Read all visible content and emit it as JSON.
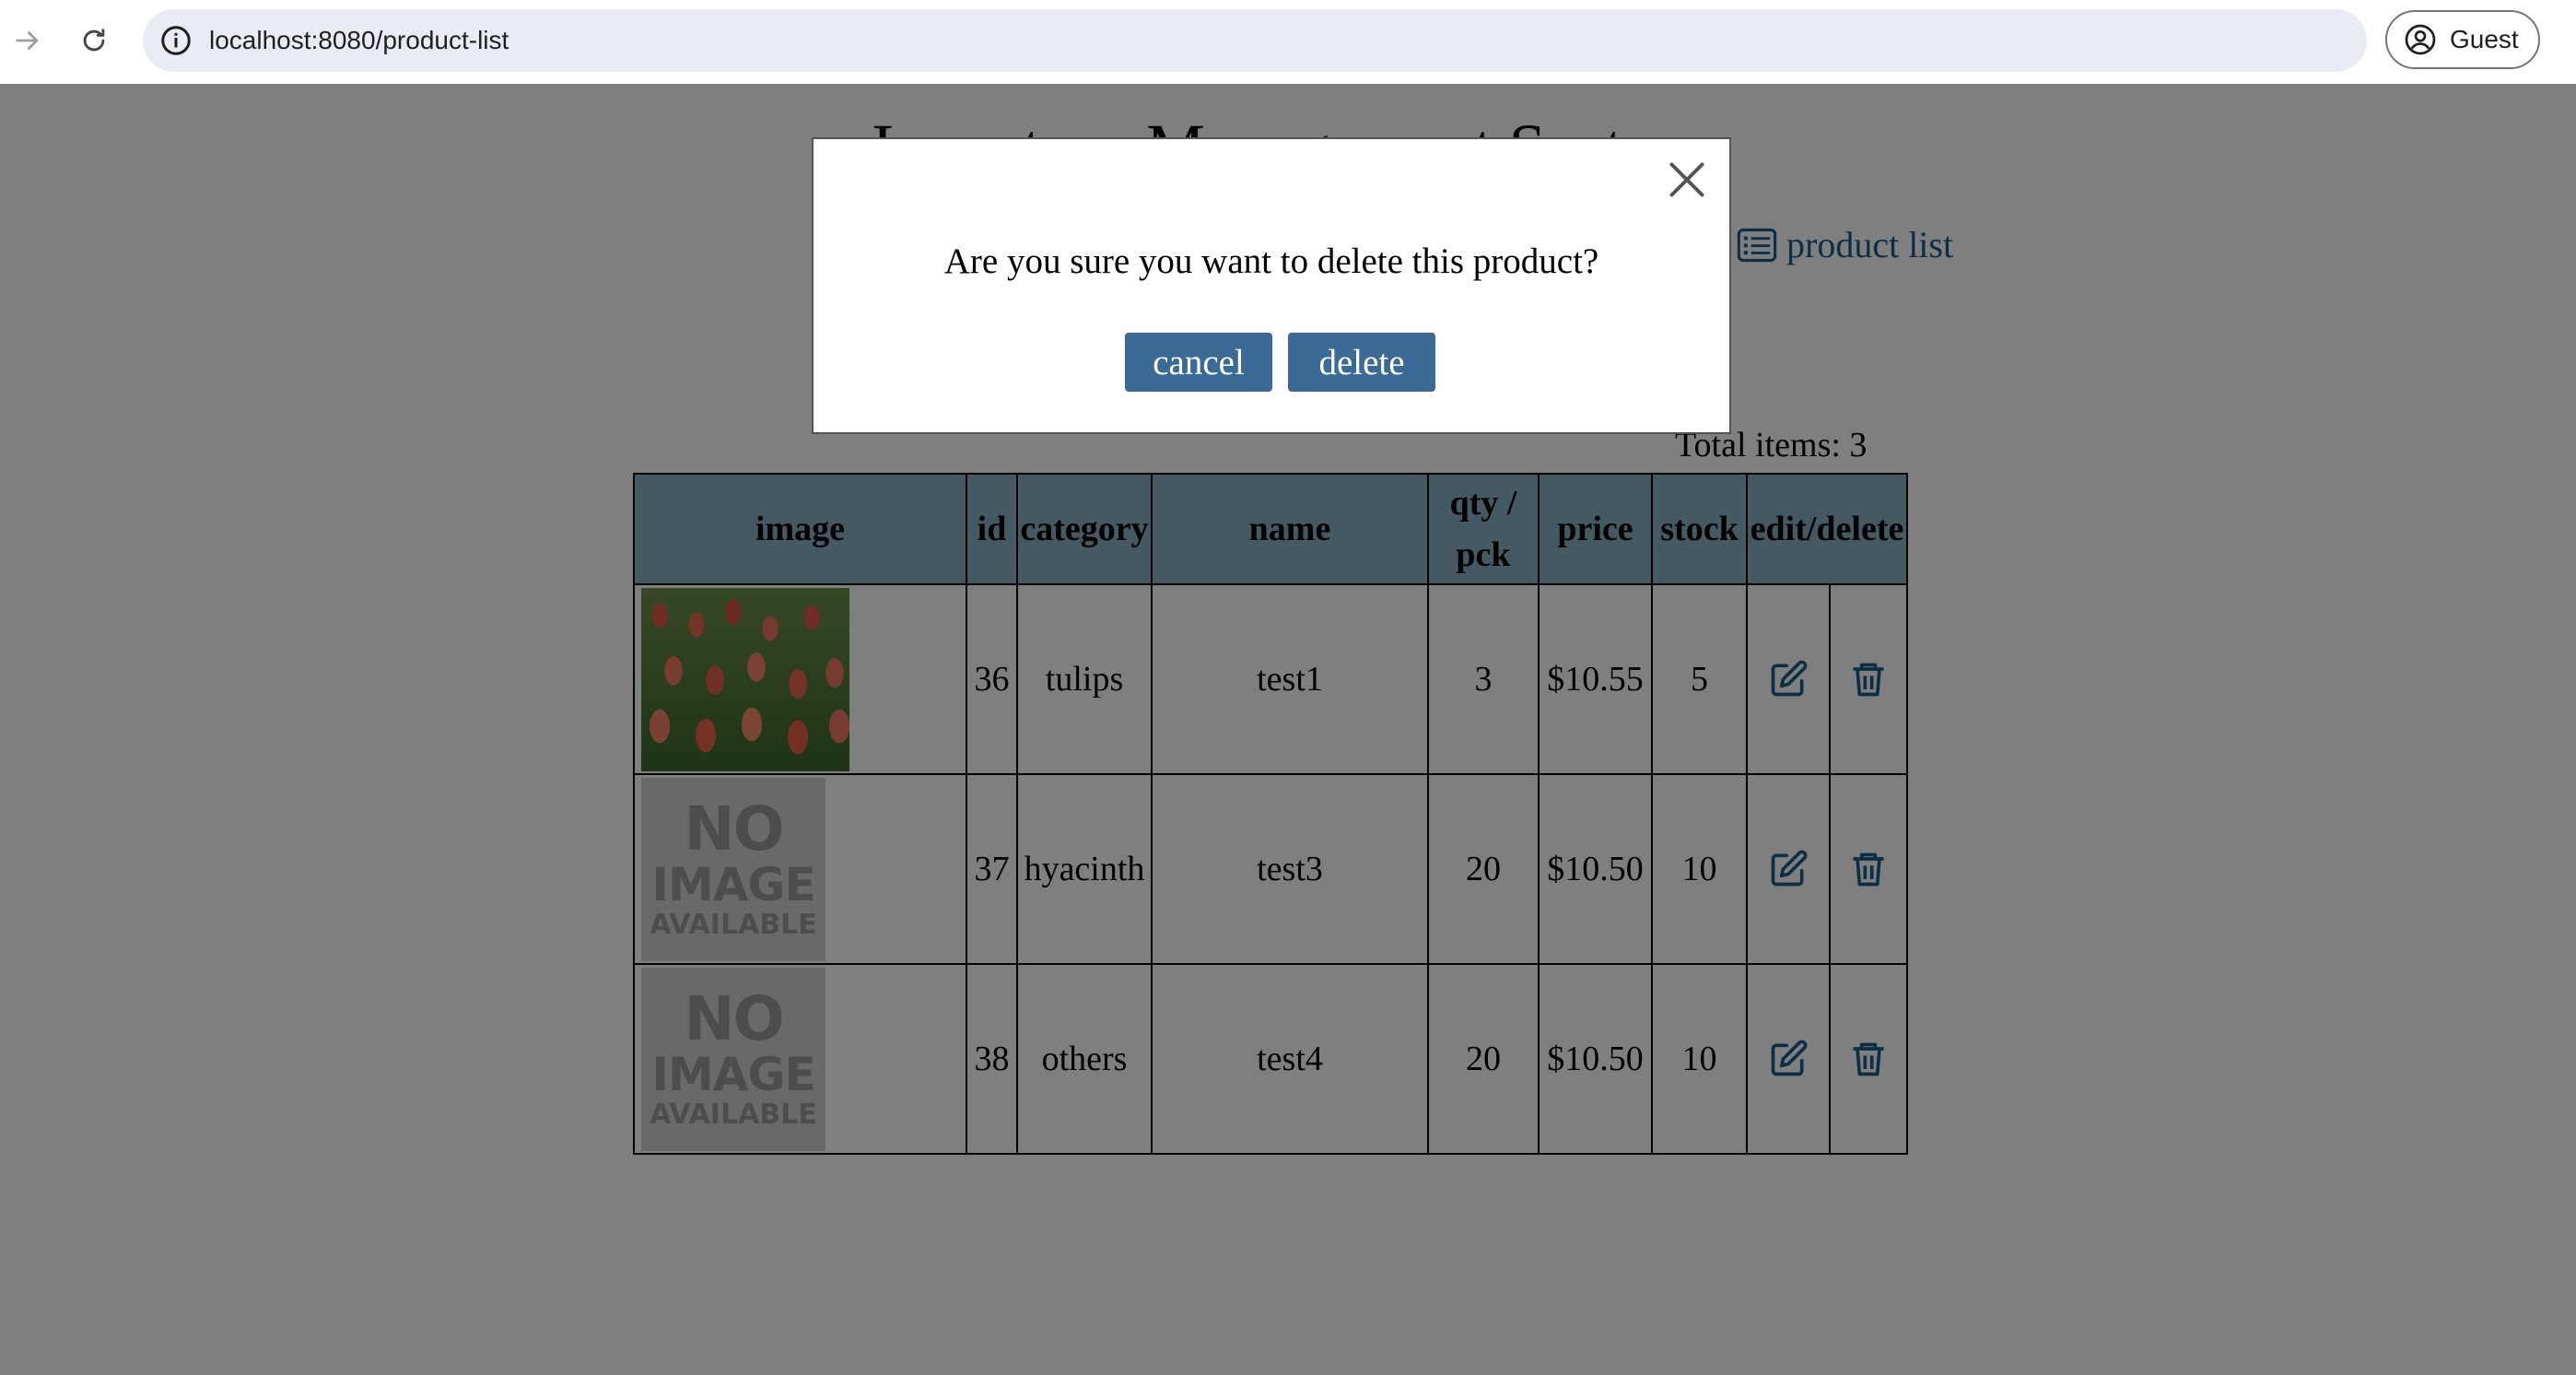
{
  "browser": {
    "url": "localhost:8080/product-list",
    "profile_label": "Guest"
  },
  "page": {
    "title": "Inventory Management System",
    "nav_link_label": "product list",
    "total_items": "Total items: 3"
  },
  "table": {
    "headers": [
      "image",
      "id",
      "category",
      "name",
      "qty / pck",
      "price",
      "stock",
      "edit/delete"
    ],
    "rows": [
      {
        "image": "tulips-photo",
        "id": "36",
        "category": "tulips",
        "name": "test1",
        "qty": "3",
        "price": "$10.55",
        "stock": "5"
      },
      {
        "image": "no-image",
        "id": "37",
        "category": "hyacinth",
        "name": "test3",
        "qty": "20",
        "price": "$10.50",
        "stock": "10"
      },
      {
        "image": "no-image",
        "id": "38",
        "category": "others",
        "name": "test4",
        "qty": "20",
        "price": "$10.50",
        "stock": "10"
      }
    ],
    "no_image_text": {
      "line1": "NO",
      "line2": "IMAGE",
      "line3": "AVAILABLE"
    }
  },
  "modal": {
    "question": "Are you sure you want to delete this product?",
    "cancel_label": "cancel",
    "delete_label": "delete"
  },
  "icons": {
    "back": "arrow-right-icon",
    "reload": "reload-icon",
    "site_info": "info-icon",
    "profile": "account-circle-icon",
    "nav": "list-icon",
    "edit": "edit-icon",
    "delete": "trash-icon",
    "close": "close-icon"
  },
  "colors": {
    "header_bg": "#8ab3c6",
    "link": "#1a5e8a",
    "button_bg": "#3b6a96",
    "overlay": "rgba(0,0,0,0.5)"
  }
}
